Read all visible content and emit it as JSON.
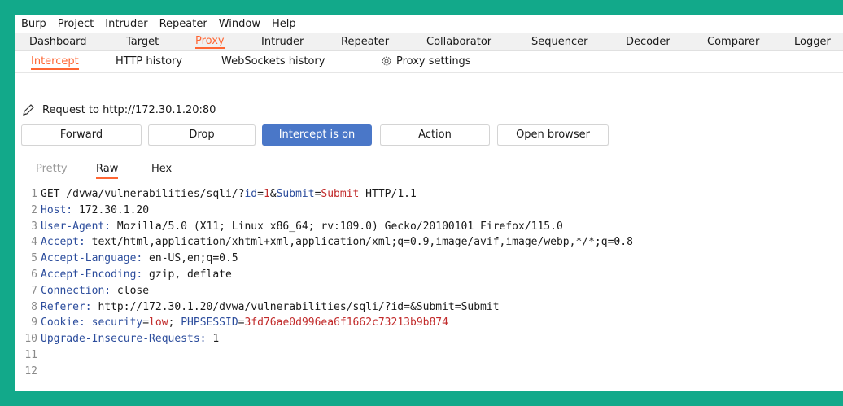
{
  "menu": [
    "Burp",
    "Project",
    "Intruder",
    "Repeater",
    "Window",
    "Help"
  ],
  "main_tabs": [
    {
      "label": "Dashboard",
      "active": false
    },
    {
      "label": "Target",
      "active": false
    },
    {
      "label": "Proxy",
      "active": true
    },
    {
      "label": "Intruder",
      "active": false
    },
    {
      "label": "Repeater",
      "active": false
    },
    {
      "label": "Collaborator",
      "active": false
    },
    {
      "label": "Sequencer",
      "active": false
    },
    {
      "label": "Decoder",
      "active": false
    },
    {
      "label": "Comparer",
      "active": false
    },
    {
      "label": "Logger",
      "active": false
    }
  ],
  "proxy_tabs": [
    {
      "label": "Intercept",
      "active": true
    },
    {
      "label": "HTTP history",
      "active": false
    },
    {
      "label": "WebSockets history",
      "active": false
    },
    {
      "label": "Proxy settings",
      "active": false,
      "icon": "gear-icon"
    }
  ],
  "request_label": "Request to http://172.30.1.20:80",
  "buttons": [
    {
      "label": "Forward"
    },
    {
      "label": "Drop"
    },
    {
      "label": "Intercept is on",
      "active": true
    },
    {
      "label": "Action"
    },
    {
      "label": "Open browser"
    }
  ],
  "editor_tabs": [
    {
      "label": "Pretty",
      "state": "muted"
    },
    {
      "label": "Raw",
      "state": "active"
    },
    {
      "label": "Hex",
      "state": "normal"
    }
  ],
  "colors": {
    "accent": "#ff6633",
    "intercept_on": "#4a77c8",
    "header_key": "#2b4c9c",
    "param_value": "#c12a2a",
    "border": "#12a98a"
  },
  "request_lines": [
    {
      "num": "1",
      "parts": [
        {
          "t": "GET /dvwa/vulnerabilities/sqli/?",
          "c": "plain"
        },
        {
          "t": "id",
          "c": "pk"
        },
        {
          "t": "=",
          "c": "plain"
        },
        {
          "t": "1",
          "c": "pv"
        },
        {
          "t": "&",
          "c": "plain"
        },
        {
          "t": "Submit",
          "c": "pk"
        },
        {
          "t": "=",
          "c": "plain"
        },
        {
          "t": "Submit",
          "c": "pv"
        },
        {
          "t": " HTTP/1.1",
          "c": "plain"
        }
      ]
    },
    {
      "num": "2",
      "parts": [
        {
          "t": "Host:",
          "c": "hk"
        },
        {
          "t": " 172.30.1.20",
          "c": "plain"
        }
      ]
    },
    {
      "num": "3",
      "parts": [
        {
          "t": "User-Agent:",
          "c": "hk"
        },
        {
          "t": " Mozilla/5.0 (X11; Linux x86_64; rv:109.0) Gecko/20100101 Firefox/115.0",
          "c": "plain"
        }
      ]
    },
    {
      "num": "4",
      "parts": [
        {
          "t": "Accept:",
          "c": "hk"
        },
        {
          "t": " text/html,application/xhtml+xml,application/xml;q=0.9,image/avif,image/webp,*/*;q=0.8",
          "c": "plain"
        }
      ]
    },
    {
      "num": "5",
      "parts": [
        {
          "t": "Accept-Language:",
          "c": "hk"
        },
        {
          "t": " en-US,en;q=0.5",
          "c": "plain"
        }
      ]
    },
    {
      "num": "6",
      "parts": [
        {
          "t": "Accept-Encoding:",
          "c": "hk"
        },
        {
          "t": " gzip, deflate",
          "c": "plain"
        }
      ]
    },
    {
      "num": "7",
      "parts": [
        {
          "t": "Connection:",
          "c": "hk"
        },
        {
          "t": " close",
          "c": "plain"
        }
      ]
    },
    {
      "num": "8",
      "parts": [
        {
          "t": "Referer:",
          "c": "hk"
        },
        {
          "t": " http://172.30.1.20/dvwa/vulnerabilities/sqli/?id=&Submit=Submit",
          "c": "plain"
        }
      ]
    },
    {
      "num": "9",
      "parts": [
        {
          "t": "Cookie:",
          "c": "hk"
        },
        {
          "t": " ",
          "c": "plain"
        },
        {
          "t": "security",
          "c": "pk"
        },
        {
          "t": "=",
          "c": "plain"
        },
        {
          "t": "low",
          "c": "pv"
        },
        {
          "t": "; ",
          "c": "plain"
        },
        {
          "t": "PHPSESSID",
          "c": "pk"
        },
        {
          "t": "=",
          "c": "plain"
        },
        {
          "t": "3fd76ae0d996ea6f1662c73213b9b874",
          "c": "pv"
        }
      ]
    },
    {
      "num": "10",
      "parts": [
        {
          "t": "Upgrade-Insecure-Requests:",
          "c": "hk"
        },
        {
          "t": " 1",
          "c": "plain"
        }
      ]
    },
    {
      "num": "11",
      "parts": []
    },
    {
      "num": "12",
      "parts": []
    }
  ]
}
